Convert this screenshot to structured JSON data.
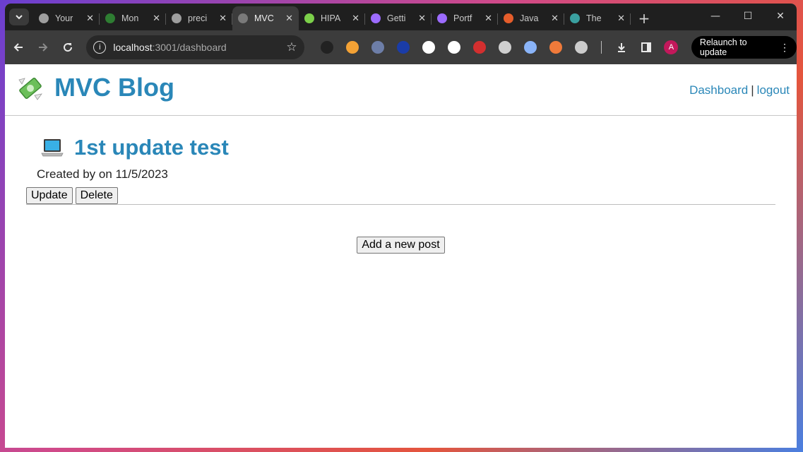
{
  "browser": {
    "tabs": [
      {
        "title": "Your",
        "favicon_color": "#9e9e9e",
        "active": false
      },
      {
        "title": "Mon",
        "favicon_color": "#2e7d32",
        "active": false
      },
      {
        "title": "preci",
        "favicon_color": "#9e9e9e",
        "active": false
      },
      {
        "title": "MVC",
        "favicon_color": "#7a7a7a",
        "active": true
      },
      {
        "title": "HIPA",
        "favicon_color": "#7cd04a",
        "active": false
      },
      {
        "title": "Getti",
        "favicon_color": "#9c6bff",
        "active": false
      },
      {
        "title": "Portf",
        "favicon_color": "#9c6bff",
        "active": false
      },
      {
        "title": "Java",
        "favicon_color": "#e55d2b",
        "active": false
      },
      {
        "title": "The",
        "favicon_color": "#3aa0a0",
        "active": false
      }
    ],
    "tab_close_glyph": "✕",
    "new_tab_glyph": "+",
    "url_host": "localhost",
    "url_path": ":3001/dashboard",
    "avatar_letter": "A",
    "relaunch_label": "Relaunch to update",
    "extension_colors": [
      "#222",
      "#f4a235",
      "#6d7ea8",
      "#1a3ca8",
      "#ffffff",
      "#ffffff",
      "#d32f2f",
      "#cfcfcf",
      "#8ab4f8",
      "#f07a3a",
      "#cccccc"
    ]
  },
  "site": {
    "title": "MVC Blog",
    "nav": {
      "dashboard": "Dashboard",
      "separator": "|",
      "logout": "logout"
    },
    "accent_color": "#2a87b8"
  },
  "post": {
    "title": "1st update test",
    "meta": "Created by on 11/5/2023",
    "update_label": "Update",
    "delete_label": "Delete"
  },
  "add_post_label": "Add a new post"
}
